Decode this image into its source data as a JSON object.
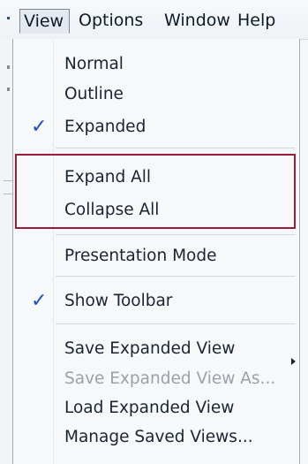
{
  "menubar": {
    "items": [
      "View",
      "Options",
      "Window",
      "Help"
    ]
  },
  "menu": {
    "group_view": [
      "Normal",
      "Outline",
      "Expanded"
    ],
    "group_expand": [
      "Expand All",
      "Collapse All"
    ],
    "presentation": "Presentation Mode",
    "toolbar": "Show Toolbar",
    "group_saved": [
      "Save Expanded View",
      "Save Expanded View As...",
      "Load Expanded View",
      "Manage Saved Views..."
    ],
    "check_glyph": "✓"
  },
  "colors": {
    "check": "#1c4fb0",
    "highlight_border": "#9b1b3a",
    "disabled_text": "#9aa1aa"
  },
  "states": {
    "expanded_checked": true,
    "show_toolbar_checked": true,
    "save_as_disabled": true,
    "load_has_submenu": true
  }
}
